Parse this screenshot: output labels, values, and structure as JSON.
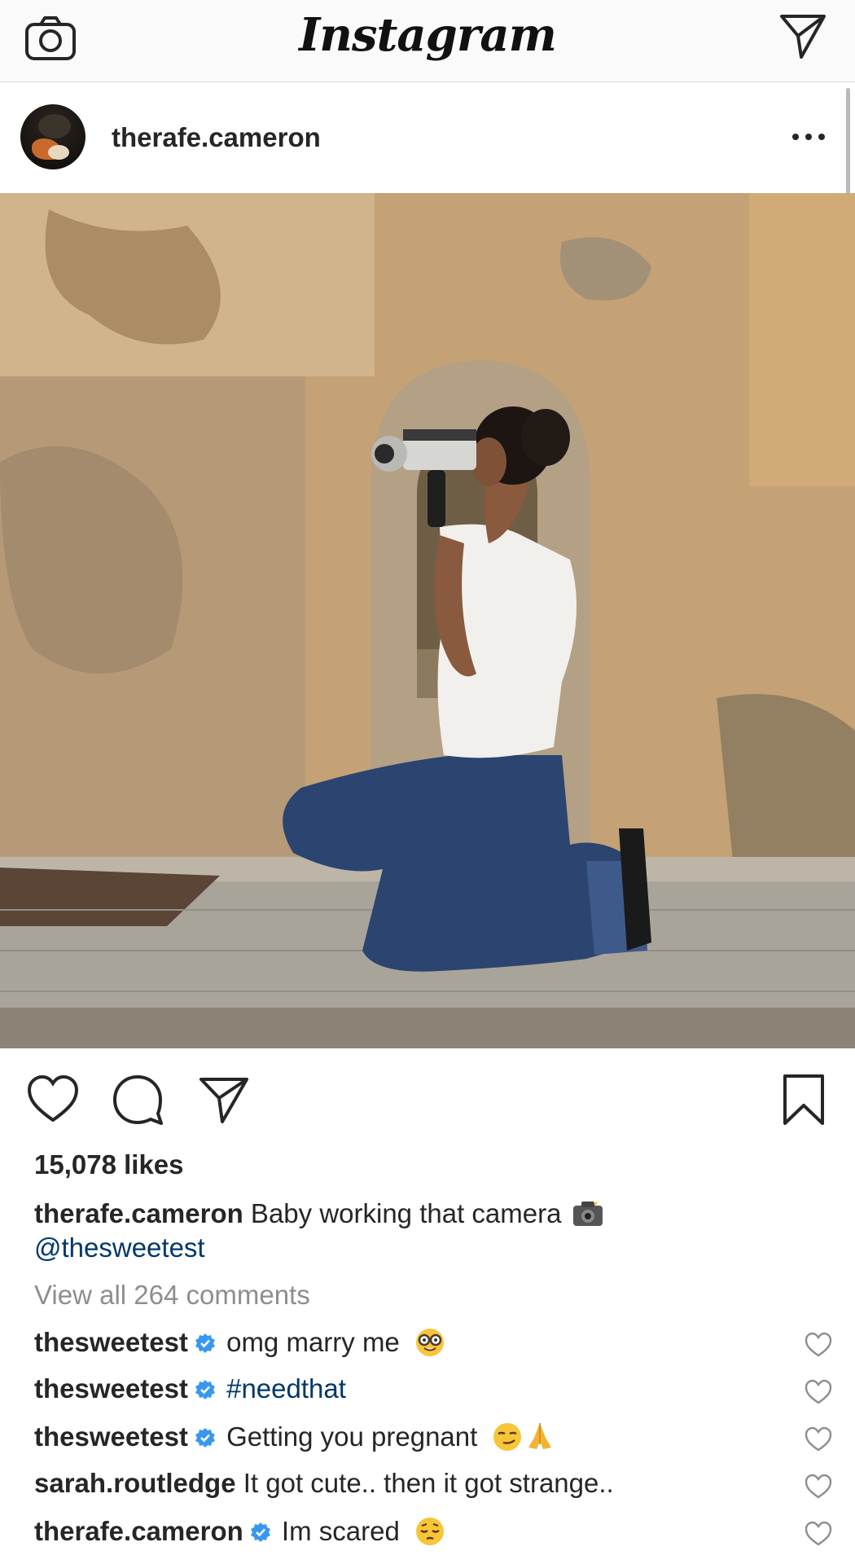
{
  "app": {
    "title": "Instagram"
  },
  "post": {
    "username": "therafe.cameron",
    "photo_alt": "",
    "likes": "15,078 likes",
    "caption_user": "therafe.cameron",
    "caption_text": " Baby working that camera",
    "caption_mention": "@thesweetest",
    "view_all": "View all 264 comments"
  },
  "comments": [
    {
      "user": "thesweetest",
      "verified": true,
      "text": "omg marry me",
      "hashtag": "",
      "emoji": "nerd-face"
    },
    {
      "user": "thesweetest",
      "verified": true,
      "text": "",
      "hashtag": "#needthat",
      "emoji": ""
    },
    {
      "user": "thesweetest",
      "verified": true,
      "text": "Getting you pregnant",
      "hashtag": "",
      "emoji": "smirk-pray"
    },
    {
      "user": "sarah.routledge",
      "verified": false,
      "text": " It got cute.. then it got strange..",
      "hashtag": "",
      "emoji": ""
    },
    {
      "user": "therafe.cameron",
      "verified": true,
      "text": "Im scared",
      "hashtag": "",
      "emoji": "pensive-face"
    }
  ],
  "icons": {
    "camera": "camera-icon",
    "direct": "paper-plane-icon",
    "more": "more-options-icon",
    "like": "heart-icon",
    "comment": "comment-bubble-icon",
    "share": "paper-plane-icon",
    "save": "bookmark-icon",
    "verified": "verified-badge-icon"
  },
  "colors": {
    "link": "#00376b",
    "muted": "#8e8e8e",
    "verified": "#3897f0",
    "text": "#262626"
  }
}
